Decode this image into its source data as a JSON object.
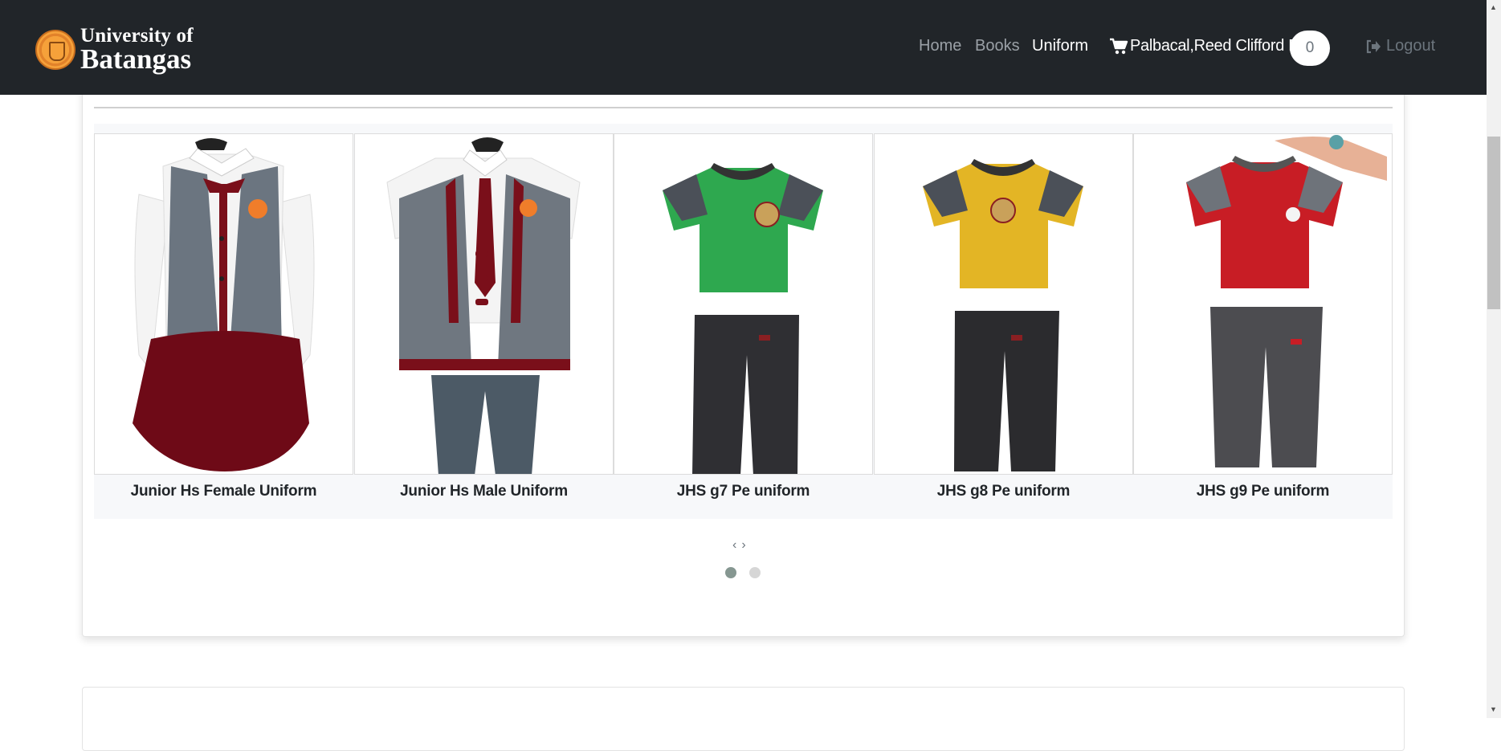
{
  "header": {
    "brand_line1": "University of",
    "brand_line2": "Batangas",
    "nav": [
      {
        "label": "Home",
        "active": false
      },
      {
        "label": "Books",
        "active": false
      },
      {
        "label": "Uniform",
        "active": true
      }
    ],
    "user_name": "Palbacal,Reed Clifford D.",
    "cart_count": "0",
    "logout_label": "Logout"
  },
  "carousel": {
    "products": [
      {
        "name": "Junior Hs Female Uniform",
        "image": "female-uniform-image"
      },
      {
        "name": "Junior Hs Male Uniform",
        "image": "male-uniform-image"
      },
      {
        "name": "JHS g7 Pe uniform",
        "image": "green-pe-uniform-image"
      },
      {
        "name": "JHS g8 Pe uniform",
        "image": "yellow-pe-uniform-image"
      },
      {
        "name": "JHS g9 Pe uniform",
        "image": "red-pe-uniform-image"
      }
    ],
    "prev_label": "‹",
    "next_label": "›",
    "pages": 2,
    "active_page": 1
  },
  "colors": {
    "navbar": "#212529",
    "green_shirt": "#2ea84f",
    "yellow_shirt": "#e3b525",
    "red_shirt": "#c81d25",
    "vest_gray": "#6f7780",
    "maroon": "#7a0f1a"
  }
}
